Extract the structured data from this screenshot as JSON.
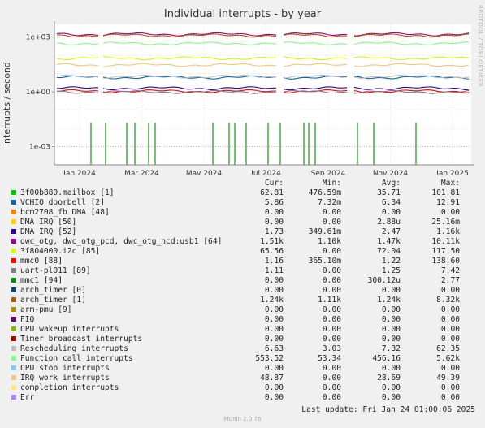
{
  "title": "Individual interrupts - by year",
  "side_label": "RRDTOOL / TOBI OETIKER",
  "footer": {
    "last_update": "Last update: Fri Jan 24 01:00:06 2025",
    "version": "Munin 2.0.76"
  },
  "chart_data": {
    "type": "line",
    "title": "Individual interrupts - by year",
    "ylabel": "interrupts / second",
    "yscale": "log",
    "ylim": [
      0.0001,
      5000
    ],
    "y_ticks": [
      {
        "label": "1e+03",
        "value": 1000
      },
      {
        "label": "1e+00",
        "value": 1
      },
      {
        "label": "1e-03",
        "value": 0.001
      }
    ],
    "x_ticks": [
      "Jan 2024",
      "Mar 2024",
      "May 2024",
      "Jul 2024",
      "Sep 2024",
      "Nov 2024",
      "Jan 2025"
    ],
    "grid": true,
    "legend_columns": [
      "Cur:",
      "Min:",
      "Avg:",
      "Max:"
    ],
    "series": [
      {
        "name": "3f00b880.mailbox [1]",
        "color": "#00cc00",
        "cur": "62.81",
        "min": "476.59m",
        "avg": "35.71",
        "max": "101.81",
        "level": 0
      },
      {
        "name": "VCHIQ doorbell [2]",
        "color": "#0066b3",
        "cur": "5.86",
        "min": "7.32m",
        "avg": "6.34",
        "max": "12.91",
        "level": 6.3
      },
      {
        "name": "bcm2708_fb DMA [48]",
        "color": "#ff8000",
        "cur": "0.00",
        "min": "0.00",
        "avg": "0.00",
        "max": "0.00",
        "level": 0
      },
      {
        "name": "DMA IRQ [50]",
        "color": "#ffcc00",
        "cur": "0.00",
        "min": "0.00",
        "avg": "2.88u",
        "max": "25.16m",
        "level": 0
      },
      {
        "name": "DMA IRQ [52]",
        "color": "#330099",
        "cur": "1.73",
        "min": "349.61m",
        "avg": "2.47",
        "max": "1.16k",
        "level": 1.6
      },
      {
        "name": "dwc_otg, dwc_otg_pcd, dwc_otg_hcd:usb1 [64]",
        "color": "#990099",
        "cur": "1.51k",
        "min": "1.10k",
        "avg": "1.47k",
        "max": "10.11k",
        "level": 1450
      },
      {
        "name": "3f804000.i2c [85]",
        "color": "#ccff00",
        "cur": "65.56",
        "min": "0.00",
        "avg": "72.04",
        "max": "117.50",
        "level": 70
      },
      {
        "name": "mmc0 [88]",
        "color": "#ff0000",
        "cur": "1.16",
        "min": "365.10m",
        "avg": "1.22",
        "max": "138.60",
        "level": 1.1
      },
      {
        "name": "uart-pl011 [89]",
        "color": "#808080",
        "cur": "1.11",
        "min": "0.00",
        "avg": "1.25",
        "max": "7.42",
        "level": 1.0
      },
      {
        "name": "mmc1 [94]",
        "color": "#008f00",
        "cur": "0.00",
        "min": "0.00",
        "avg": "300.12u",
        "max": "2.77",
        "level": 0
      },
      {
        "name": "arch_timer [0]",
        "color": "#00487d",
        "cur": "0.00",
        "min": "0.00",
        "avg": "0.00",
        "max": "0.00",
        "level": 0
      },
      {
        "name": "arch_timer [1]",
        "color": "#b35a00",
        "cur": "1.24k",
        "min": "1.11k",
        "avg": "1.24k",
        "max": "8.32k",
        "level": 1240
      },
      {
        "name": "arm-pmu [9]",
        "color": "#b38f00",
        "cur": "0.00",
        "min": "0.00",
        "avg": "0.00",
        "max": "0.00",
        "level": 0
      },
      {
        "name": "FIQ",
        "color": "#6b006b",
        "cur": "0.00",
        "min": "0.00",
        "avg": "0.00",
        "max": "0.00",
        "level": 0
      },
      {
        "name": "CPU wakeup interrupts",
        "color": "#8fb300",
        "cur": "0.00",
        "min": "0.00",
        "avg": "0.00",
        "max": "0.00",
        "level": 0
      },
      {
        "name": "Timer broadcast interrupts",
        "color": "#b30000",
        "cur": "0.00",
        "min": "0.00",
        "avg": "0.00",
        "max": "0.00",
        "level": 0
      },
      {
        "name": "Rescheduling interrupts",
        "color": "#bebebe",
        "cur": "6.63",
        "min": "3.03",
        "avg": "7.32",
        "max": "62.35",
        "level": 7
      },
      {
        "name": "Function call interrupts",
        "color": "#80ff80",
        "cur": "553.52",
        "min": "53.34",
        "avg": "456.16",
        "max": "5.62k",
        "level": 450
      },
      {
        "name": "CPU stop interrupts",
        "color": "#80c9ff",
        "cur": "0.00",
        "min": "0.00",
        "avg": "0.00",
        "max": "0.00",
        "level": 0
      },
      {
        "name": "IRQ work interrupts",
        "color": "#ffc080",
        "cur": "48.87",
        "min": "0.00",
        "avg": "28.69",
        "max": "49.39",
        "level": 30
      },
      {
        "name": "completion interrupts",
        "color": "#ffe680",
        "cur": "0.00",
        "min": "0.00",
        "avg": "0.00",
        "max": "0.00",
        "level": 0
      },
      {
        "name": "Err",
        "color": "#aa80ff",
        "cur": "0.00",
        "min": "0.00",
        "avg": "0.00",
        "max": "0.00",
        "level": 0
      }
    ]
  }
}
